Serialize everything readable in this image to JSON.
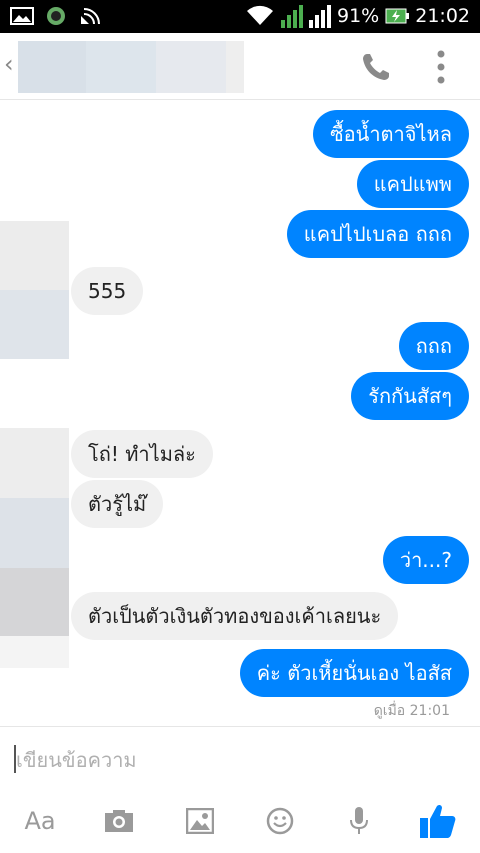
{
  "statusbar": {
    "battery": "91%",
    "time": "21:02",
    "sim1": "1",
    "sim2": "2"
  },
  "header": {
    "back_glyph": "‹"
  },
  "messages": [
    {
      "dir": "out",
      "text": "ซื้อน้ำตาจิไหล"
    },
    {
      "dir": "out",
      "text": "แคปแพพ"
    },
    {
      "dir": "out",
      "text": "แคปไปเบลอ ถถถ"
    },
    {
      "dir": "in",
      "text": "555"
    },
    {
      "dir": "out",
      "text": "ถถถ"
    },
    {
      "dir": "out",
      "text": "รักกันสัสๆ"
    },
    {
      "dir": "in",
      "text": "โถ่! ทำไมล่ะ"
    },
    {
      "dir": "in",
      "text": "ตัวรู้ไม๊"
    },
    {
      "dir": "out",
      "text": "ว่า...?"
    },
    {
      "dir": "in",
      "text": "ตัวเป็นตัวเงินตัวทองของเค้าเลยนะ"
    },
    {
      "dir": "out",
      "text": "ค่ะ ตัวเหี้ยนั่นเอง ไอสัส"
    }
  ],
  "seen_status": "ดูเมื่อ 21:01",
  "composer": {
    "placeholder": "เขียนข้อความ"
  },
  "toolbar": {
    "text_label": "Aa",
    "icons": [
      "text-format-icon",
      "camera-icon",
      "image-icon",
      "emoji-icon",
      "microphone-icon",
      "thumbs-up-icon"
    ]
  },
  "colors": {
    "outgoing": "#0084ff",
    "incoming": "#f0f0f0",
    "accent": "#0084ff"
  }
}
